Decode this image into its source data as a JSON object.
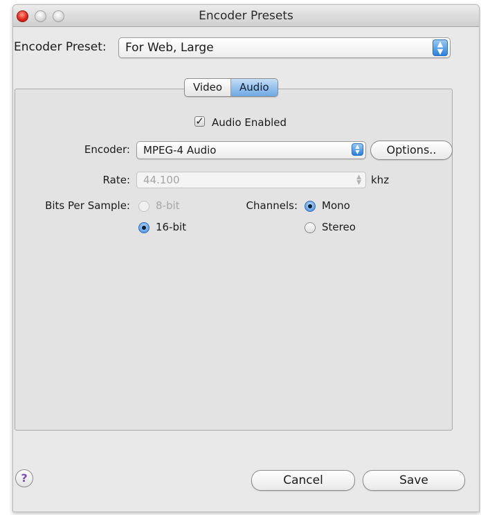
{
  "window": {
    "title": "Encoder Presets",
    "controls": [
      "close-button",
      "minimize-button",
      "zoom-button"
    ]
  },
  "preset": {
    "label": "Encoder Preset:",
    "value": "For Web, Large"
  },
  "tabs": [
    {
      "label": "Video",
      "selected": false
    },
    {
      "label": "Audio",
      "selected": true
    }
  ],
  "audio": {
    "enabled_label": "Audio Enabled",
    "enabled_checked": true,
    "encoder_label": "Encoder:",
    "encoder_value": "MPEG-4 Audio",
    "options_label": "Options..",
    "rate_label": "Rate:",
    "rate_value": "44.100",
    "rate_unit": "khz",
    "bits_label": "Bits Per Sample:",
    "bits_options": [
      {
        "label": "8-bit",
        "selected": false,
        "enabled": false
      },
      {
        "label": "16-bit",
        "selected": true,
        "enabled": true
      }
    ],
    "channels_label": "Channels:",
    "channel_options": [
      {
        "label": "Mono",
        "selected": true
      },
      {
        "label": "Stereo",
        "selected": false
      }
    ]
  },
  "footer": {
    "help_label": "?",
    "cancel_label": "Cancel",
    "save_label": "Save"
  },
  "colors": {
    "accent": "#2a7fd8",
    "close_red": "#e0281a",
    "help_purple": "#7b4fb5"
  }
}
